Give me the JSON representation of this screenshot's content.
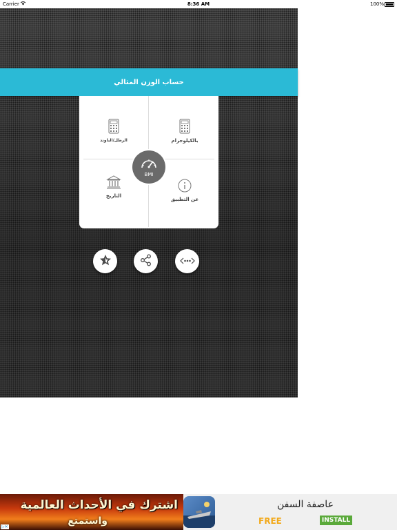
{
  "status_bar": {
    "carrier": "Carrier",
    "time": "8:36 AM",
    "battery": "100%"
  },
  "app": {
    "title": "حساب الوزن المثالي",
    "menu": {
      "kilogram_label": "بالكيلوجرام",
      "pound_label": "الرطل/الباوند",
      "history_label": "التاريخ",
      "about_label": "عن التطبيق",
      "bmi_label": "BMI"
    },
    "actions": [
      "favorite",
      "share",
      "more"
    ]
  },
  "ad": {
    "image_text_line1": "اشترك في الأحداث العالمية",
    "image_text_line2": "واستمتع",
    "app_title": "عاصفة السفن",
    "free_label": "FREE",
    "install_label": "INSTALL",
    "colors": {
      "free": "#f2a91b",
      "install": "#5aa93a"
    }
  },
  "colors": {
    "title_bar": "#2bbad6",
    "background": "#3c3c3c",
    "bmi_gauge": "#6a6a6a"
  }
}
